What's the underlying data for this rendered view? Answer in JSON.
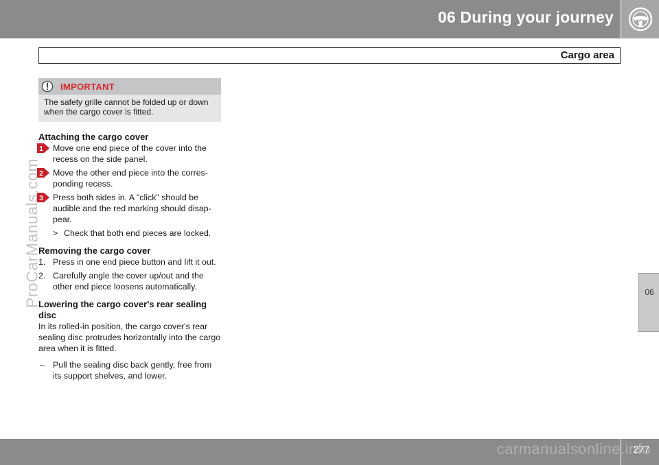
{
  "header": {
    "chapter_title": "06 During your journey",
    "chapter_icon": "steering-wheel-icon",
    "section_title": "Cargo area"
  },
  "side_tab": {
    "label": "06"
  },
  "watermarks": {
    "left": "ProCarManuals.com",
    "bottom": "carmanualsonline.info"
  },
  "footer": {
    "page_number": "277"
  },
  "important": {
    "label": "IMPORTANT",
    "icon": "exclamation-icon",
    "text": "The safety grille cannot be folded up or down when the cargo cover is fitted."
  },
  "attaching": {
    "heading": "Attaching the cargo cover",
    "steps": [
      {
        "num": "1",
        "text": "Move one end piece of the cover into the recess on the side panel."
      },
      {
        "num": "2",
        "text": "Move the other end piece into the corres-ponding recess."
      },
      {
        "num": "3",
        "text": "Press both sides in. A \"click\" should be audible and the red marking should disap-pear."
      }
    ],
    "result_symbol": ">",
    "result_text": "Check that both end pieces are locked."
  },
  "removing": {
    "heading": "Removing the cargo cover",
    "items": [
      {
        "num": "1.",
        "text": "Press in one end piece button and lift it out."
      },
      {
        "num": "2.",
        "text": "Carefully angle the cover up/out and the other end piece loosens automatically."
      }
    ]
  },
  "lowering": {
    "heading": "Lowering the cargo cover's rear sealing disc",
    "paragraph": "In its rolled-in position, the cargo cover's rear sealing disc protrudes horizontally into the cargo area when it is fitted.",
    "dash_symbol": "–",
    "dash_text": "Pull the sealing disc back gently, free from its support shelves, and lower."
  },
  "colors": {
    "header_gray": "#8a8b8d",
    "important_red": "#d7262f",
    "step_badge_red": "#c8202a"
  }
}
